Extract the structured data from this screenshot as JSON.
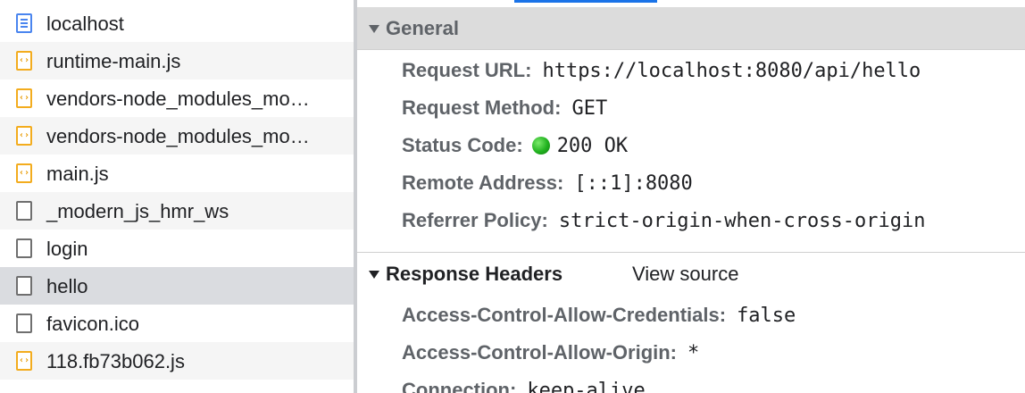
{
  "requests": [
    {
      "name": "localhost",
      "icon": "document-icon"
    },
    {
      "name": "runtime-main.js",
      "icon": "script-file-icon"
    },
    {
      "name": "vendors-node_modules_mo…",
      "icon": "script-file-icon"
    },
    {
      "name": "vendors-node_modules_mo…",
      "icon": "script-file-icon"
    },
    {
      "name": "main.js",
      "icon": "script-file-icon"
    },
    {
      "name": "_modern_js_hmr_ws",
      "icon": "blank-file-icon"
    },
    {
      "name": "login",
      "icon": "blank-file-icon"
    },
    {
      "name": "hello",
      "icon": "blank-file-icon",
      "selected": true
    },
    {
      "name": "favicon.ico",
      "icon": "blank-file-icon"
    },
    {
      "name": "118.fb73b062.js",
      "icon": "script-file-icon"
    }
  ],
  "general": {
    "title": "General",
    "request_url_key": "Request URL:",
    "request_url_value": "https://localhost:8080/api/hello",
    "request_method_key": "Request Method:",
    "request_method_value": "GET",
    "status_code_key": "Status Code:",
    "status_code_value": "200 OK",
    "remote_address_key": "Remote Address:",
    "remote_address_value": "[::1]:8080",
    "referrer_policy_key": "Referrer Policy:",
    "referrer_policy_value": "strict-origin-when-cross-origin"
  },
  "response_headers": {
    "title": "Response Headers",
    "view_source_label": "View source",
    "allow_credentials_key": "Access-Control-Allow-Credentials:",
    "allow_credentials_value": "false",
    "allow_origin_key": "Access-Control-Allow-Origin:",
    "allow_origin_value": "*",
    "connection_key": "Connection:",
    "connection_value": "keep-alive"
  },
  "colors": {
    "accent": "#1a73e8",
    "status_ok": "#21b21f",
    "js_icon": "#f3ac1e",
    "doc_icon": "#4a85ef"
  }
}
